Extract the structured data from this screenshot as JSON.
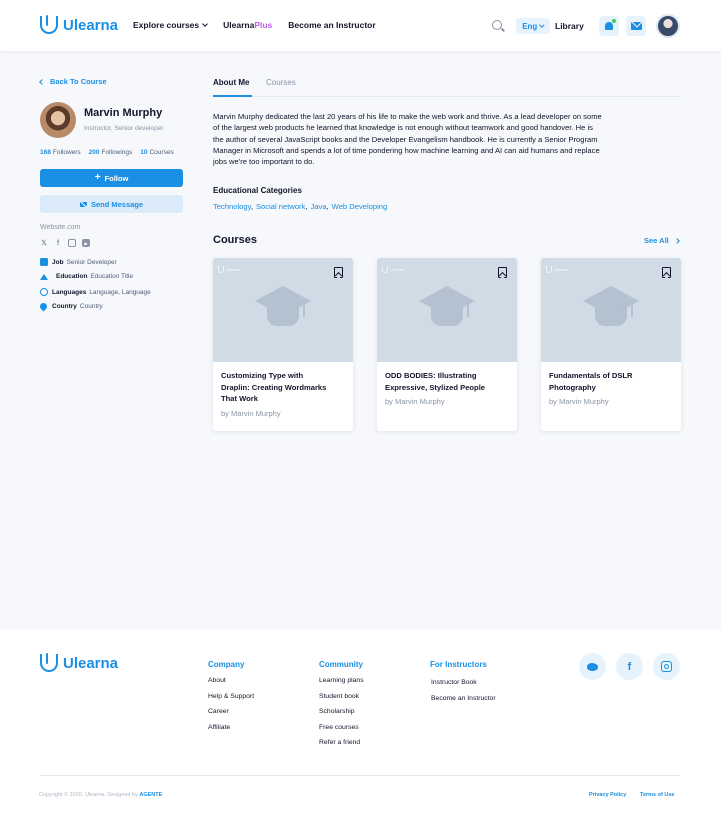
{
  "brand": {
    "name": "Ulearna"
  },
  "header": {
    "nav": {
      "explore": "Explore courses",
      "plus_prefix": "Ulearna",
      "plus_suffix": "Plus",
      "instructor": "Become an Instructor"
    },
    "language": "Eng",
    "library": "Library",
    "notification_dot": true
  },
  "sidebar": {
    "back_label": "Back To Course",
    "name": "Marvin Murphy",
    "subtitle": "Instructor, Senior developer",
    "stats": [
      {
        "num": "168",
        "label": "Followers"
      },
      {
        "num": "200",
        "label": "Followings"
      },
      {
        "num": "10",
        "label": "Courses"
      }
    ],
    "follow_label": "Follow",
    "message_label": "Send Message",
    "website": "Website.com",
    "social_icons": [
      "twitter-icon",
      "facebook-icon",
      "instagram-icon",
      "youtube-icon"
    ],
    "info": [
      {
        "key": "Job",
        "value": "Senior Developer",
        "icon": "job-icon"
      },
      {
        "key": "Education",
        "value": "Education Title",
        "icon": "education-icon"
      },
      {
        "key": "Languages",
        "value": "Language, Language",
        "icon": "globe-icon"
      },
      {
        "key": "Country",
        "value": "Country",
        "icon": "location-pin-icon"
      }
    ]
  },
  "main": {
    "tabs": [
      {
        "label": "About Me",
        "active": true
      },
      {
        "label": "Courses",
        "active": false
      }
    ],
    "bio": [
      "Marvin Murphy dedicated the last 20 years of his life to make the web work and thrive. As a lead developer on some",
      "of the largest web products he learned that knowledge is not enough without teamwork and good handover. He is",
      "the author of several JavaScript books and the Developer Evangelism handbook. He is currently a Senior Program",
      "Manager in Microsoft and spends a lot of time pondering how machine learning and AI can aid humans and replace",
      "jobs we're too important to do."
    ],
    "categories_title": "Educational Categories",
    "categories": [
      "Technology",
      "Social network",
      "Java",
      "Web Developing"
    ],
    "categories_separator": ",",
    "courses_title": "Courses",
    "see_all": "See All",
    "courses": [
      {
        "title_lines": [
          "Customizing Type with",
          "Draplin: Creating Wordmarks",
          "That Work"
        ],
        "author": "by Marvin Murphy",
        "thumb_logo": "Ulearna"
      },
      {
        "title_lines": [
          "ODD BODIES: Illustrating",
          "Expressive, Stylized People"
        ],
        "author": "by Marvin Murphy",
        "thumb_logo": "Ulearna"
      },
      {
        "title_lines": [
          "Fundamentals of DSLR",
          "Photography"
        ],
        "author": "by Marvin Murphy",
        "thumb_logo": "Ulearna"
      }
    ]
  },
  "footer": {
    "columns": [
      {
        "title": "Company",
        "links": [
          "About",
          "Help & Support",
          "Career",
          "Affiliate"
        ]
      },
      {
        "title": "Community",
        "links": [
          "Learning plans",
          "Student book",
          "Scholarship",
          "Free courses",
          "Refer a friend"
        ]
      },
      {
        "title": "For Instructors",
        "links": [
          "Instructor Book",
          "Become an Instructor"
        ]
      }
    ],
    "socials": [
      "twitter-icon",
      "facebook-icon",
      "instagram-icon"
    ],
    "facebook_glyph": "f",
    "copyright_prefix": "Copyright © 2020. Ulearna. Designed by",
    "designer": "AGENTE",
    "privacy": "Privacy Policy",
    "terms": "Terms of Use"
  },
  "colors": {
    "accent": "#1a8fe3",
    "plus": "#c35cf3",
    "background": "#f6f8fb",
    "thumb": "#d1dbe6"
  }
}
